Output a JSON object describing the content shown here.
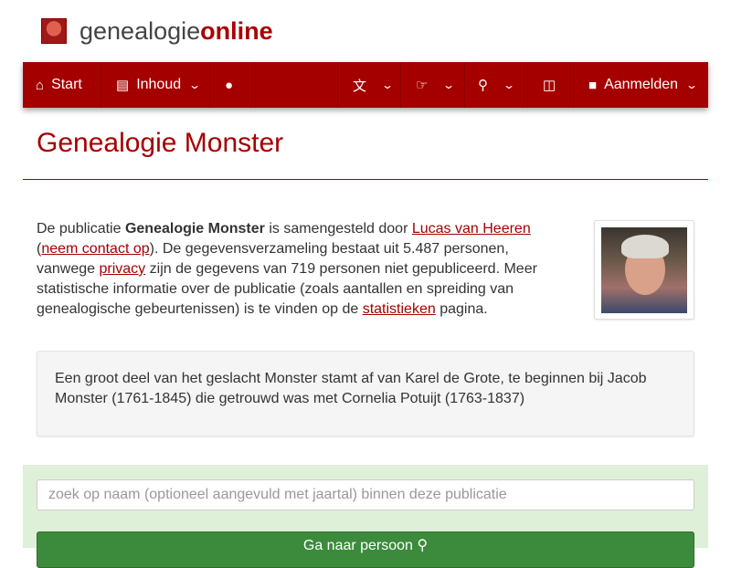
{
  "brand": {
    "name_part1": "genealogie",
    "name_part2": "online"
  },
  "nav": {
    "start": {
      "label": "Start",
      "icon": "home-icon"
    },
    "inhoud": {
      "label": "Inhoud",
      "icon": "book-icon"
    },
    "chat": {
      "icon": "chat-icon"
    },
    "language": {
      "icon": "translate-icon"
    },
    "like": {
      "icon": "thumbs-up-icon"
    },
    "search": {
      "icon": "search-icon"
    },
    "cart": {
      "icon": "cart-icon"
    },
    "login": {
      "label": "Aanmelden",
      "icon": "lock-icon"
    }
  },
  "page": {
    "title": "Genealogie Monster"
  },
  "intro": {
    "t1": "De publicatie ",
    "pub_name": "Genealogie Monster",
    "t2": " is samengesteld door ",
    "author_link": "Lucas van Heeren",
    "t3": " (",
    "contact_link": "neem contact op",
    "t4": "). De gegevensverzameling bestaat uit 5.487 personen, vanwege ",
    "privacy_link": "privacy",
    "t5": " zijn de gegevens van 719 personen niet gepubliceerd. Meer statistische informatie over de publicatie (zoals aantallen en spreiding van genealogische gebeurtenissen) is te vinden op de ",
    "stats_link": "statistieken",
    "t6": " pagina."
  },
  "description": "Een groot deel van het geslacht Monster stamt af van Karel de Grote, te beginnen bij Jacob Monster (1761-1845) die getrouwd was met Cornelia Potuijt (1763-1837)",
  "search": {
    "placeholder": "zoek op naam (optioneel aangevuld met jaartal) binnen deze publicatie",
    "value": "",
    "button_label": "Ga naar persoon"
  },
  "colors": {
    "brand": "#a50000",
    "success_panel": "#dff0d8",
    "button": "#3c8a3c"
  }
}
